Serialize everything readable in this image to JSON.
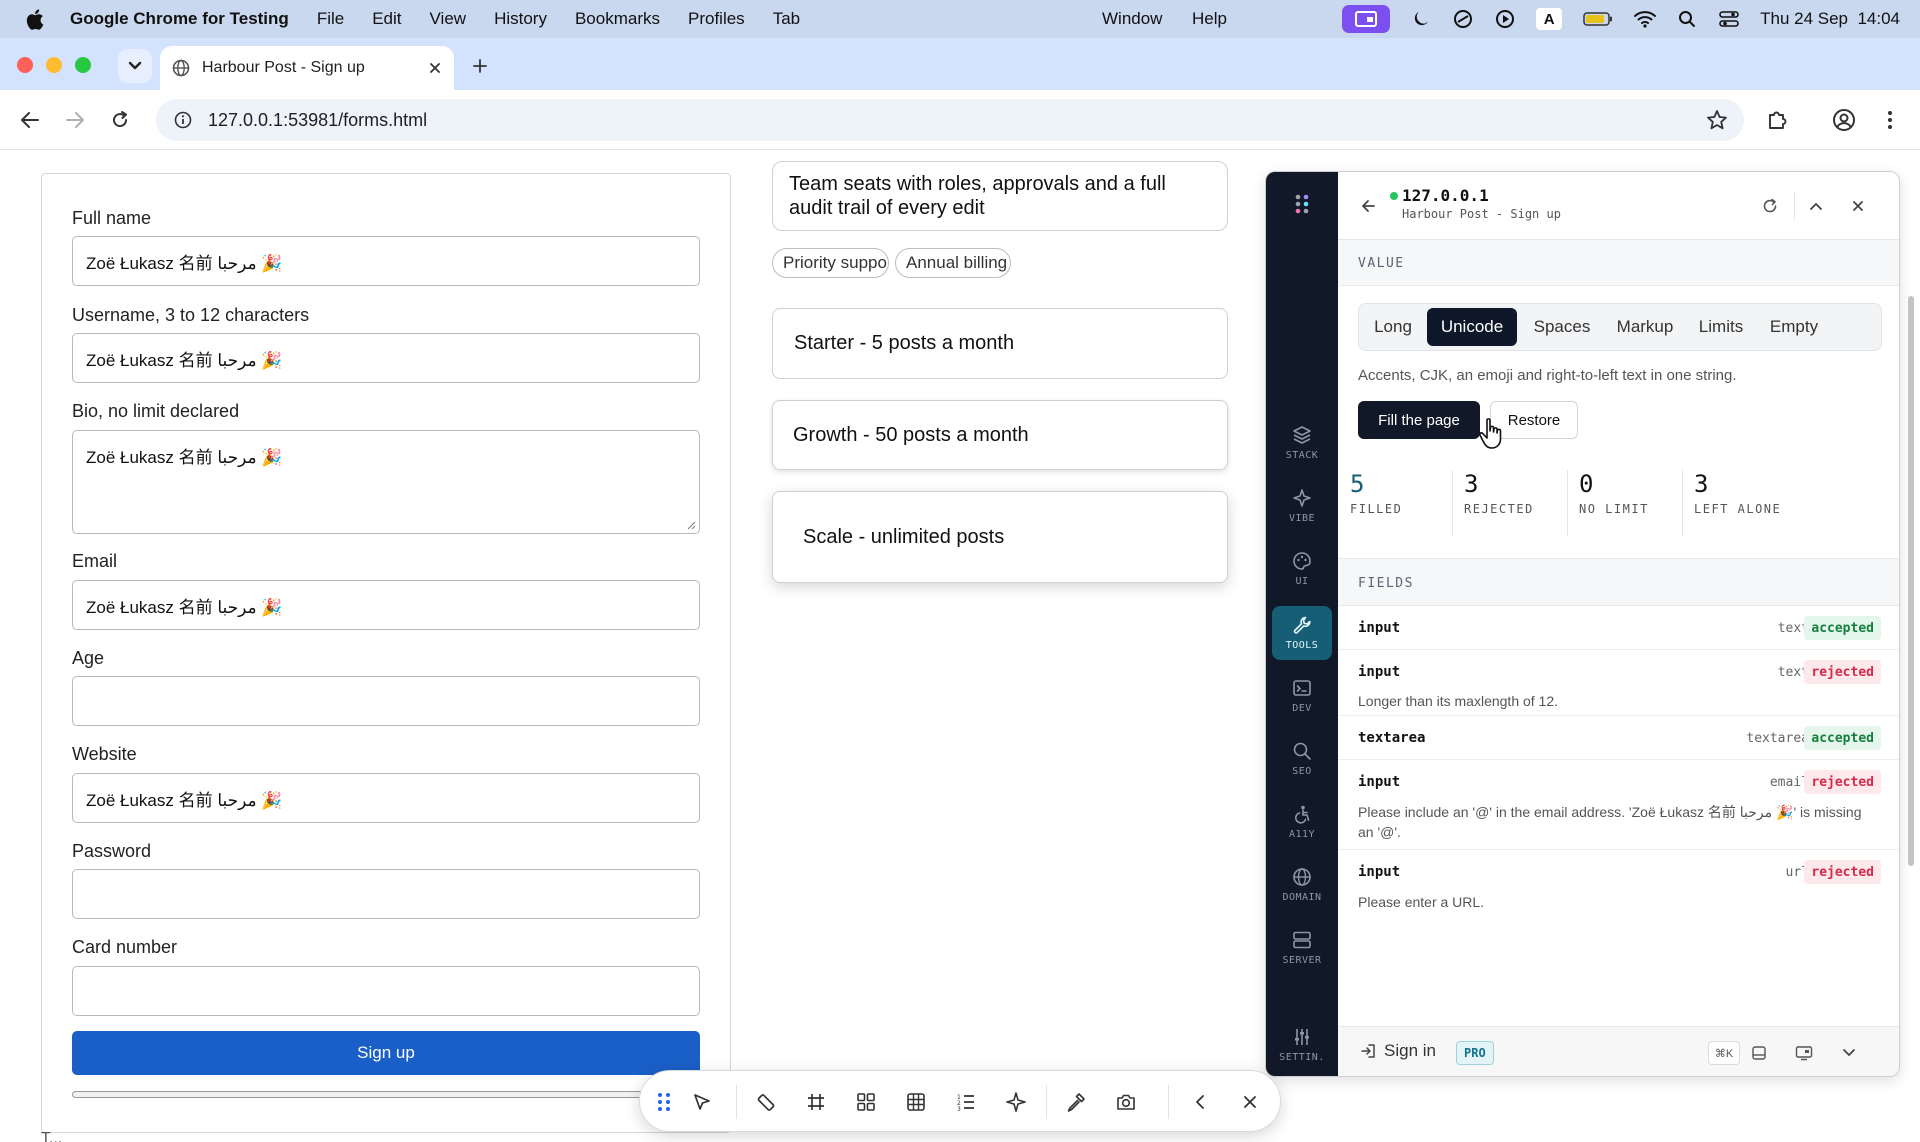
{
  "menubar": {
    "app_name": "Google Chrome for Testing",
    "menus": [
      "File",
      "Edit",
      "View",
      "History",
      "Bookmarks",
      "Profiles",
      "Tab",
      "Window",
      "Help"
    ],
    "datetime": "Thu 24 Sep  14:04"
  },
  "tab": {
    "title": "Harbour Post - Sign up"
  },
  "toolbar": {
    "url": "127.0.0.1:53981/forms.html"
  },
  "form": {
    "fields": [
      {
        "label": "Full name",
        "value": "Zoë Łukasz 名前 مرحبا 🎉"
      },
      {
        "label": "Username, 3 to 12 characters",
        "value": "Zoë Łukasz 名前 مرحبا 🎉"
      },
      {
        "label": "Bio, no limit declared",
        "value": "Zoë Łukasz 名前 مرحبا 🎉"
      },
      {
        "label": "Email",
        "value": "Zoë Łukasz 名前 مرحبا 🎉"
      },
      {
        "label": "Age",
        "value": ""
      },
      {
        "label": "Website",
        "value": "Zoë Łukasz 名前 مرحبا 🎉"
      },
      {
        "label": "Password",
        "value": ""
      },
      {
        "label": "Card number",
        "value": ""
      }
    ],
    "submit_label": "Sign up",
    "bottom_cut_text": "T..."
  },
  "plans": {
    "blurb": "Team seats with roles, approvals and a full audit trail of every edit",
    "chips": [
      "Priority support",
      "Annual billing"
    ],
    "options": [
      "Starter - 5 posts a month",
      "Growth - 50 posts a month",
      "Scale - unlimited posts"
    ]
  },
  "extension": {
    "host": "127.0.0.1",
    "page_title": "Harbour Post - Sign up",
    "rail": [
      "STACK",
      "VIBE",
      "UI",
      "TOOLS",
      "DEV",
      "SEO",
      "A11Y",
      "DOMAIN",
      "SERVER",
      "SETTIN."
    ],
    "value_heading": "VALUE",
    "segments": [
      "Long",
      "Unicode",
      "Spaces",
      "Markup",
      "Limits",
      "Empty"
    ],
    "active_segment": "Unicode",
    "segment_description": "Accents, CJK, an emoji and right-to-left text in one string.",
    "fill_label": "Fill the page",
    "restore_label": "Restore",
    "stats": [
      {
        "num": "5",
        "label": "FILLED"
      },
      {
        "num": "3",
        "label": "REJECTED"
      },
      {
        "num": "0",
        "label": "NO LIMIT"
      },
      {
        "num": "3",
        "label": "LEFT ALONE"
      }
    ],
    "fields_heading": "FIELDS",
    "fields": [
      {
        "tag": "input",
        "type": "text",
        "status": "accepted",
        "message": ""
      },
      {
        "tag": "input",
        "type": "text",
        "status": "rejected",
        "message": "Longer than its maxlength of 12."
      },
      {
        "tag": "textarea",
        "type": "textarea",
        "status": "accepted",
        "message": ""
      },
      {
        "tag": "input",
        "type": "email",
        "status": "rejected",
        "message": "Please include an '@' in the email address. 'Zoë Łukasz 名前 مرحبا 🎉' is missing an '@'."
      },
      {
        "tag": "input",
        "type": "url",
        "status": "rejected",
        "message": "Please enter a URL."
      }
    ],
    "signin_label": "Sign in",
    "pro_label": "PRO",
    "shortcut": "⌘K"
  },
  "colors": {
    "accent": "#155e75",
    "primary_button": "#1a5fc7",
    "accepted": "#15803d",
    "rejected": "#d6294a"
  }
}
